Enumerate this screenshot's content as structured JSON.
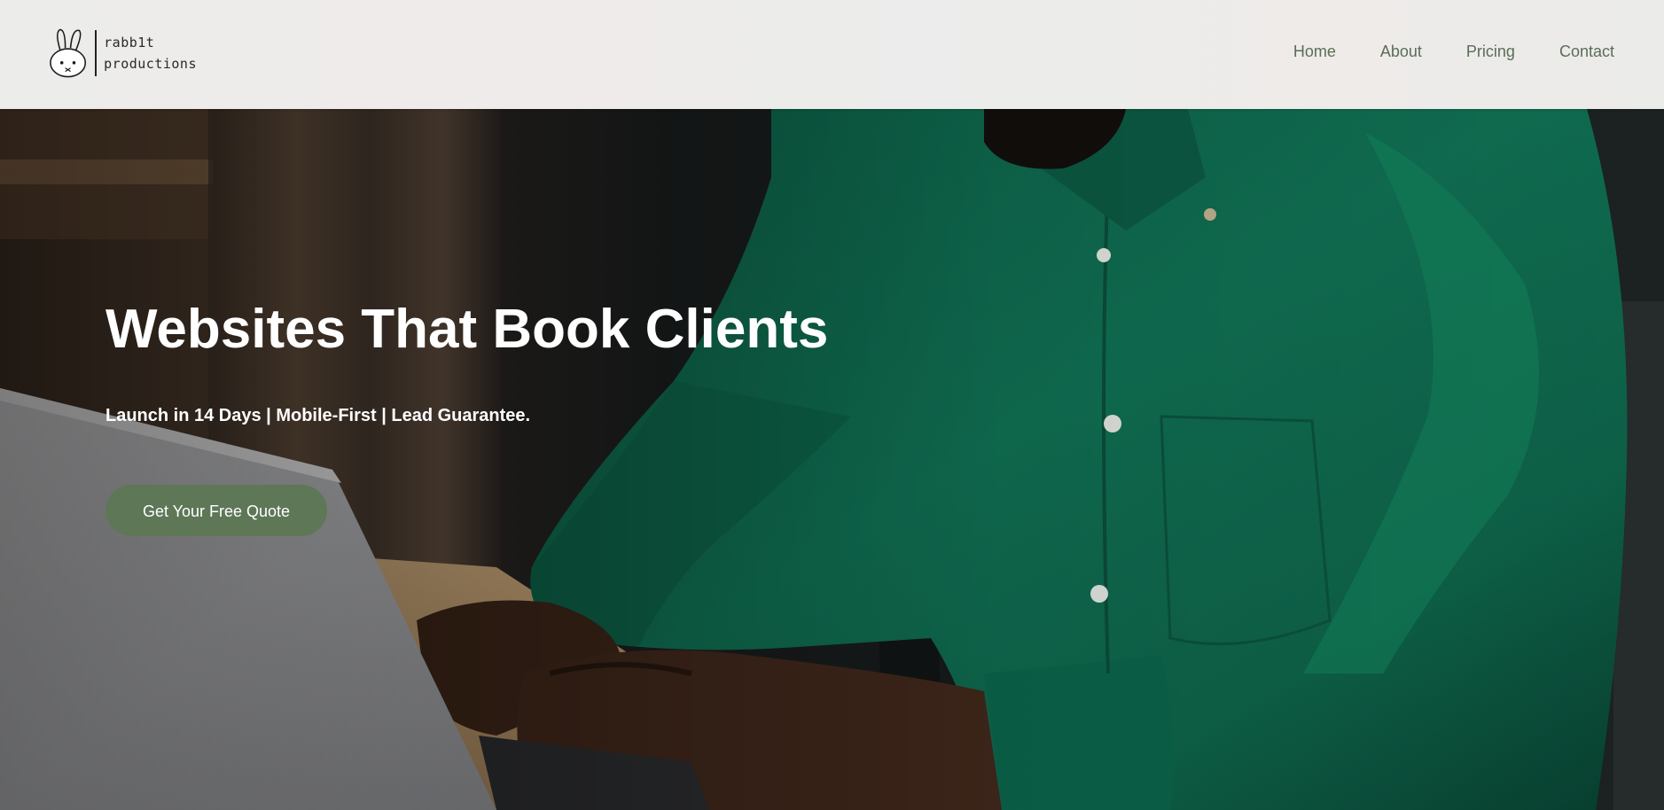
{
  "header": {
    "logo": {
      "line1": "rabb1t",
      "line2": "productions"
    },
    "nav": [
      {
        "label": "Home"
      },
      {
        "label": "About"
      },
      {
        "label": "Pricing"
      },
      {
        "label": "Contact"
      }
    ]
  },
  "hero": {
    "title": "Websites That Book Clients",
    "subtitle": "Launch in 14 Days | Mobile-First | Lead Guarantee.",
    "cta_label": "Get Your Free Quote",
    "background_image": "person-in-green-shirt-typing-on-laptop"
  },
  "colors": {
    "accent": "#5e7757",
    "nav_text": "#5a6e55",
    "header_bg": "#ececea",
    "shirt": "#0f6b4f"
  }
}
